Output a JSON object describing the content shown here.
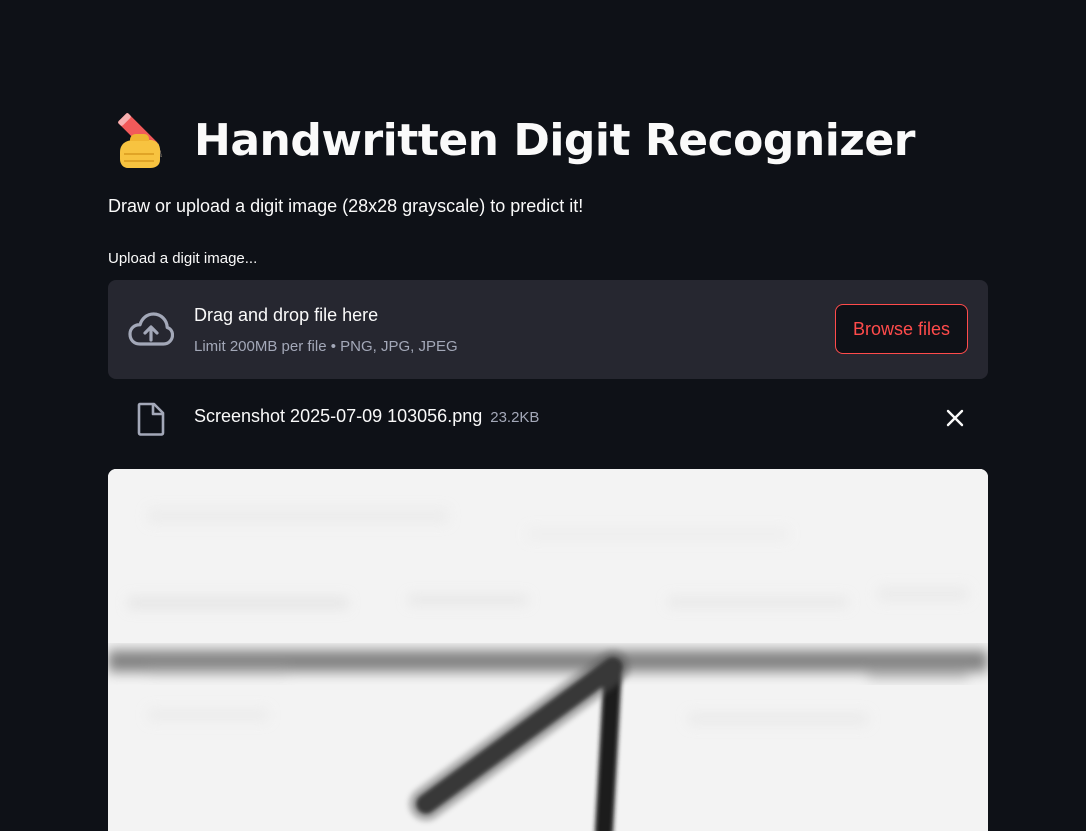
{
  "page": {
    "title_emoji": "✍️",
    "title": "Handwritten Digit Recognizer",
    "subtitle": "Draw or upload a digit image (28x28 grayscale) to predict it!"
  },
  "uploader": {
    "label": "Upload a digit image...",
    "drop_text": "Drag and drop file here",
    "limit_text": "Limit 200MB per file • PNG, JPG, JPEG",
    "browse_label": "Browse files",
    "icon": "cloud-upload-icon"
  },
  "uploaded_file": {
    "name": "Screenshot 2025-07-09 103056.png",
    "size": "23.2KB",
    "icon": "file-icon",
    "remove_icon": "close-icon"
  },
  "preview": {
    "content": "blurred handwritten digit 1 on light background"
  },
  "colors": {
    "background": "#0e1117",
    "surface": "#262730",
    "accent": "#ff4b4b",
    "text": "#fafafa",
    "muted": "#a3a8b8"
  }
}
